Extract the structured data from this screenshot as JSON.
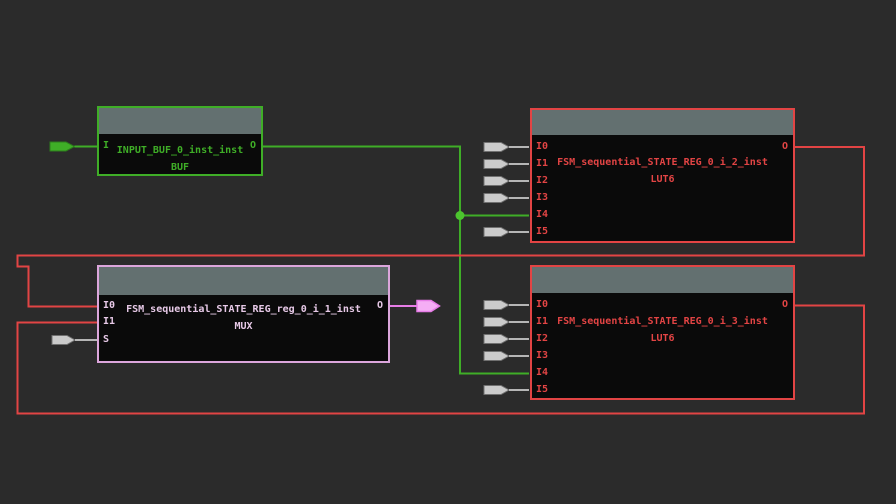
{
  "colors": {
    "bg": "#2b2b2b",
    "cellBody": "#0a0a0a",
    "cellHeader": "#637070",
    "green": "#3fae27",
    "greenBright": "#4cc42e",
    "red": "#e24444",
    "muxBorder": "#dca6dc",
    "muxText": "#e7c9e7",
    "pinkFill": "#f5aef5",
    "pinkStroke": "#e77de7",
    "stubFill": "#cbcbcb",
    "stubStroke": "#707070",
    "stubLine": "#b6b6b6"
  },
  "blocks": {
    "buf": {
      "name": "INPUT_BUF_0_inst_inst",
      "type": "BUF",
      "pins_left": [
        "I"
      ],
      "pins_right": [
        "O"
      ]
    },
    "lut6_top": {
      "name": "FSM_sequential_STATE_REG_0_i_2_inst",
      "type": "LUT6",
      "pins_left": [
        "I0",
        "I1",
        "I2",
        "I3",
        "I4",
        "I5"
      ],
      "pins_right": [
        "O"
      ]
    },
    "mux": {
      "name": "FSM_sequential_STATE_REG_reg_0_i_1_inst",
      "type": "MUX",
      "pins_left": [
        "I0",
        "I1",
        "S"
      ],
      "pins_right": [
        "O"
      ]
    },
    "lut6_bottom": {
      "name": "FSM_sequential_STATE_REG_0_i_3_inst",
      "type": "LUT6",
      "pins_left": [
        "I0",
        "I1",
        "I2",
        "I3",
        "I4",
        "I5"
      ],
      "pins_right": [
        "O"
      ]
    }
  }
}
